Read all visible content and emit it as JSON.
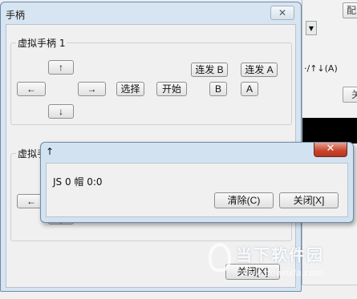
{
  "background": {
    "top_field_text": "",
    "right_button_label": "配置",
    "right_mode_text": "·/↑↓(A)",
    "right_button2_label": "关"
  },
  "main_window": {
    "title": "手柄",
    "close_glyph": "✕",
    "group1": {
      "label": "虚拟手柄 1",
      "buttons": {
        "up": "↑",
        "left": "←",
        "right": "→",
        "down": "↓",
        "select": "选择",
        "start": "开始",
        "turbo_b": "连发 B",
        "turbo_a": "连发 A",
        "b": "B",
        "a": "A"
      }
    },
    "group2": {
      "label": "虚拟手柄 ",
      "left_glyph": "←",
      "down_glyph": "↓"
    },
    "close_button_label": "关闭[X]"
  },
  "dialog": {
    "title": "↑",
    "close_glyph": "✕",
    "status_text": "JS 0 帽 0:0",
    "clear_button_label": "清除(C)",
    "close_button_label": "关闭[X]"
  },
  "watermark": {
    "text": "当下软件园",
    "url": "www.downxia.com"
  }
}
